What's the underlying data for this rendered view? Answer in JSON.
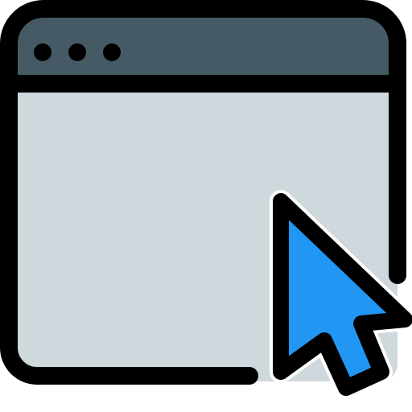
{
  "icon": {
    "name": "browser-window-cursor-icon",
    "window_dots": 3,
    "colors": {
      "outline": "#000000",
      "title_bar": "#455a64",
      "window_body": "#cfd8dc",
      "cursor": "#2196f3",
      "cursor_halo": "#ffffff",
      "dots": "#000000"
    }
  }
}
